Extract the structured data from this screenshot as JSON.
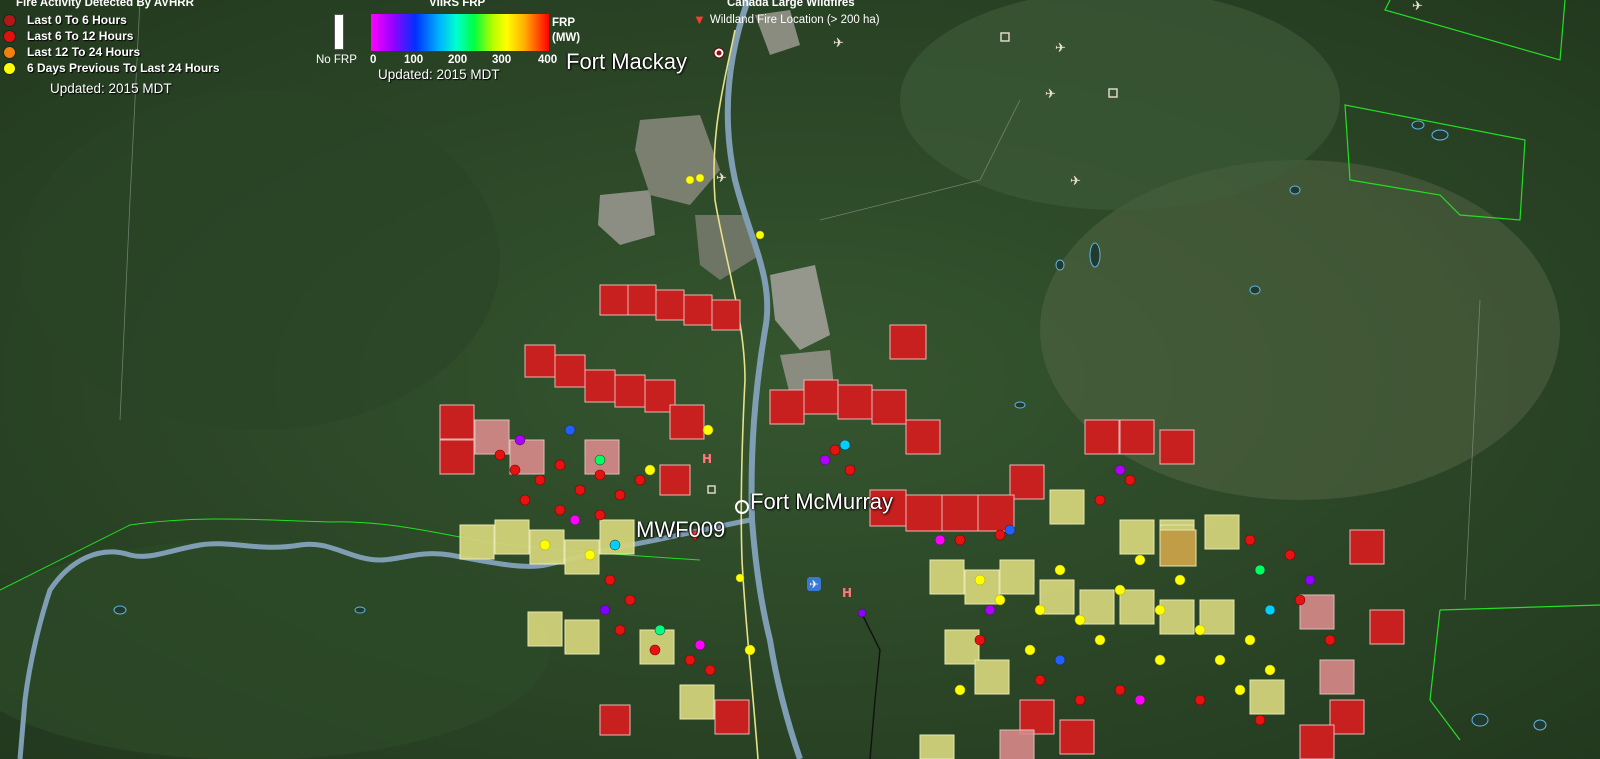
{
  "legend_avhrr": {
    "title": "Fire Activity Detected By AVHRR",
    "items": [
      {
        "label": "Last 0 To 6 Hours",
        "color": "#b01818"
      },
      {
        "label": "Last 6 To 12 Hours",
        "color": "#e01010"
      },
      {
        "label": "Last 12 To 24 Hours",
        "color": "#f08010"
      },
      {
        "label": "6 Days Previous To Last 24 Hours",
        "color": "#ffff00"
      }
    ],
    "updated": "Updated: 2015 MDT"
  },
  "legend_viirs": {
    "title": "VIIRS FRP",
    "no_frp_label": "No FRP",
    "scale_ticks": [
      "0",
      "100",
      "200",
      "300",
      "400"
    ],
    "unit_line1": "FRP",
    "unit_line2": "(MW)",
    "updated": "Updated: 2015 MDT"
  },
  "legend_large_wildfires": {
    "title": "Canada Large Wildfires",
    "pin_label": "Wildland Fire  Location (> 200 ha)",
    "pin_icon": "map-pin-icon"
  },
  "places": {
    "fort_mackay": "Fort Mackay",
    "fort_mcmurray": "Fort McMurray",
    "mwf009": "MWF009"
  },
  "colors": {
    "forest": "#2d4a2c",
    "river": "#7f9eb4",
    "highway": "#e8e08a",
    "boundary": "#22e022",
    "fire_old": "#c81f1f",
    "fire_mid": "#dc8a8a",
    "fire_yellow": "#d2d27a"
  }
}
